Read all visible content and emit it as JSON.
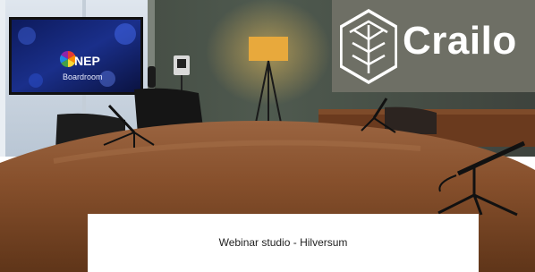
{
  "logo": {
    "brand": "Crailo",
    "icon": "hexagon-tree-icon"
  },
  "screen": {
    "brand": "NEP",
    "subtitle": "Boardroom",
    "icon": "nep-color-wheel-icon"
  },
  "caption": "Webinar studio - Hilversum",
  "colors": {
    "wall": "#4c5249",
    "table": "#8a5230",
    "logo_panel": "#6e6f65",
    "lamp": "#e8a93c"
  }
}
